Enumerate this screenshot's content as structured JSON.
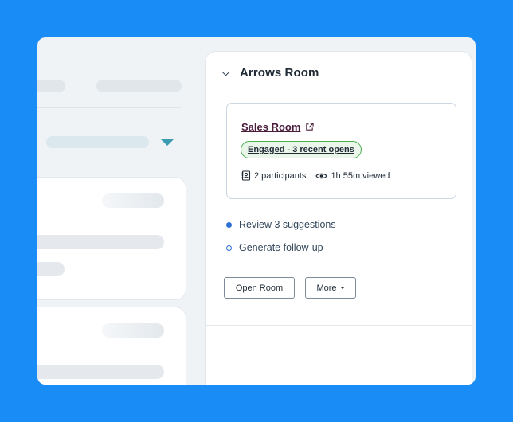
{
  "panel": {
    "title": "Arrows Room"
  },
  "room": {
    "link_label": "Sales Room",
    "status_badge": "Engaged - 3 recent opens",
    "participants": "2 participants",
    "viewed": "1h 55m viewed"
  },
  "actions": [
    {
      "label": "Review 3 suggestions",
      "indicator": "filled"
    },
    {
      "label": "Generate follow-up",
      "indicator": "hollow"
    }
  ],
  "buttons": {
    "open_room": "Open Room",
    "more": "More"
  },
  "colors": {
    "background": "#1a8cf5",
    "accent_dot": "#2b6fd6",
    "badge_border": "#4caf50",
    "link": "#4a1d3b"
  },
  "icons": {
    "collapse": "chevron-down-icon",
    "external": "external-link-icon",
    "participants": "contact-book-icon",
    "viewed": "eye-icon",
    "dropdown": "caret-down-icon"
  }
}
